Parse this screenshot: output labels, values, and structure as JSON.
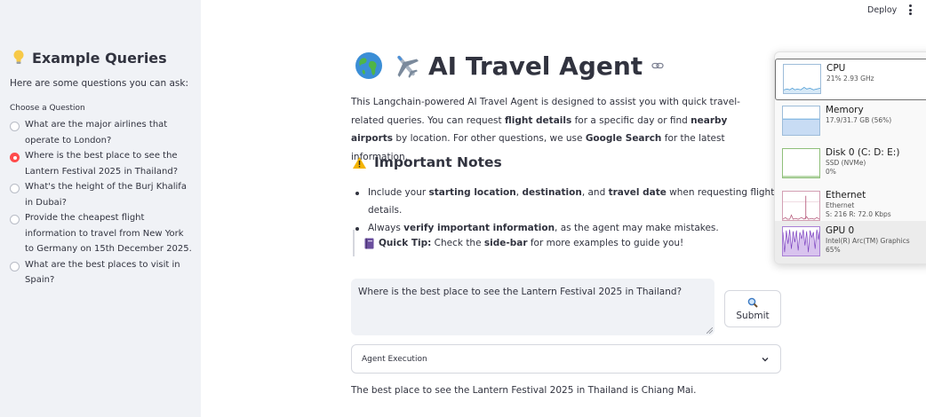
{
  "topbar": {
    "deploy_label": "Deploy"
  },
  "sidebar": {
    "title": "Example Queries",
    "subtitle": "Here are some questions you can ask:",
    "choose_label": "Choose a Question",
    "options": [
      {
        "text": "What are the major airlines that operate to London?",
        "selected": false
      },
      {
        "text": "Where is the best place to see the Lantern Festival 2025 in Thailand?",
        "selected": true
      },
      {
        "text": "What's the height of the Burj Khalifa in Dubai?",
        "selected": false
      },
      {
        "text": "Provide the cheapest flight information to travel from New York to Germany on 15th December 2025.",
        "selected": false
      },
      {
        "text": "What are the best places to visit in Spain?",
        "selected": false
      }
    ]
  },
  "main": {
    "title": "AI Travel Agent",
    "intro": {
      "p1": "This Langchain-powered AI Travel Agent is designed to assist you with quick travel-related queries. You can request ",
      "b1": "flight details",
      "p2": " for a specific day or find ",
      "b2": "nearby airports",
      "p3": " by location. For other questions, we use ",
      "b3": "Google Search",
      "p4": " for the latest information."
    },
    "notes_title": "Important Notes",
    "note1": {
      "p1": "Include your ",
      "b1": "starting location",
      "p2": ", ",
      "b2": "destination",
      "p3": ", and ",
      "b3": "travel date",
      "p4": " when requesting flight details."
    },
    "note2": {
      "p1": "Always ",
      "b1": "verify important information",
      "p2": ", as the agent may make mistakes."
    },
    "tip": {
      "b1": "Quick Tip:",
      "p1": " Check the ",
      "b2": "side-bar",
      "p2": " for more examples to guide you!"
    },
    "query_value": "Where is the best place to see the Lantern Festival 2025 in Thailand?",
    "submit_label": "Submit",
    "expander_label": "Agent Execution",
    "answer": "The best place to see the Lantern Festival 2025 in Thailand is Chiang Mai."
  },
  "task_manager": {
    "items": [
      {
        "name": "CPU",
        "detail1": "21%  2.93 GHz",
        "detail2": ""
      },
      {
        "name": "Memory",
        "detail1": "17.9/31.7 GB (56%)",
        "detail2": ""
      },
      {
        "name": "Disk 0 (C: D: E:)",
        "detail1": "SSD (NVMe)",
        "detail2": "0%"
      },
      {
        "name": "Ethernet",
        "detail1": "Ethernet",
        "detail2": "S: 216 R: 72.0 Kbps"
      },
      {
        "name": "GPU 0",
        "detail1": "Intel(R) Arc(TM) Graphics",
        "detail2": "65%"
      }
    ],
    "colors": {
      "cpu": "#4a9ad4",
      "memory": "#8b57b7",
      "disk": "#4d9b2a",
      "ethernet": "#b5587a",
      "gpu": "#7a3fbf"
    }
  },
  "icons": [
    "lightbulb-icon",
    "globe-icon",
    "airplane-icon",
    "link-icon",
    "warning-icon",
    "notebook-icon",
    "magnifier-icon",
    "chevron-down-icon",
    "kebab-menu-icon"
  ]
}
